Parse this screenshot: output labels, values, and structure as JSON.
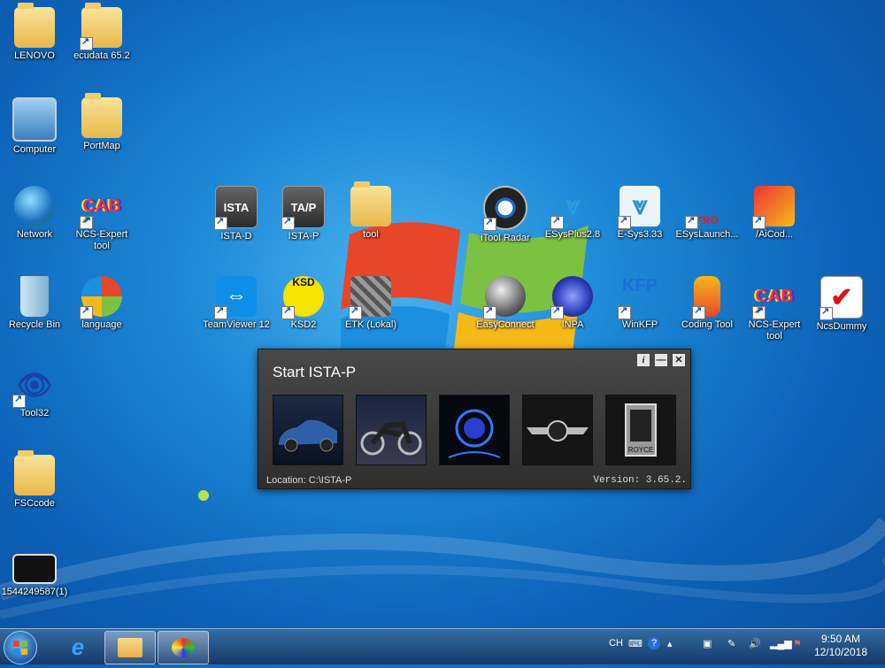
{
  "desktop": {
    "icons": [
      {
        "label": "LENOVO"
      },
      {
        "label": "ecudata 65.2"
      },
      {
        "label": "Computer"
      },
      {
        "label": "PortMap"
      },
      {
        "label": "Network"
      },
      {
        "label": "NCS-Expert tool"
      },
      {
        "label": "ISTA-D"
      },
      {
        "label": "ISTA-P"
      },
      {
        "label": "tool"
      },
      {
        "label": "iTool Radar"
      },
      {
        "label": "ESysPlus2.8"
      },
      {
        "label": "E-Sys3.33"
      },
      {
        "label": "ESysLaunch..."
      },
      {
        "label": "/AiCod..."
      },
      {
        "label": "Recycle Bin"
      },
      {
        "label": "language"
      },
      {
        "label": "TeamViewer 12"
      },
      {
        "label": "KSD2"
      },
      {
        "label": "ETK (Lokal)"
      },
      {
        "label": "EasyConnect"
      },
      {
        "label": "INPA"
      },
      {
        "label": "WinKFP"
      },
      {
        "label": "Coding Tool"
      },
      {
        "label": "NCS-Expert tool"
      },
      {
        "label": "NcsDummy"
      },
      {
        "label": "Tool32"
      },
      {
        "label": "FSCcode"
      },
      {
        "label": "1544249587(1)"
      }
    ]
  },
  "dialog": {
    "title": "Start ISTA-P",
    "info_label": "i",
    "minimize_label": "—",
    "close_label": "✕",
    "location_text": "Location:  C:\\ISTA-P",
    "version_text": "Version: 3.65.2.",
    "brands": [
      "car",
      "motorcycle",
      "bmw-i",
      "mini",
      "rolls-royce"
    ],
    "rolls_text": "ROYCE"
  },
  "taskbar": {
    "lang": "CH",
    "time": "9:50 AM",
    "date": "12/10/2018"
  }
}
